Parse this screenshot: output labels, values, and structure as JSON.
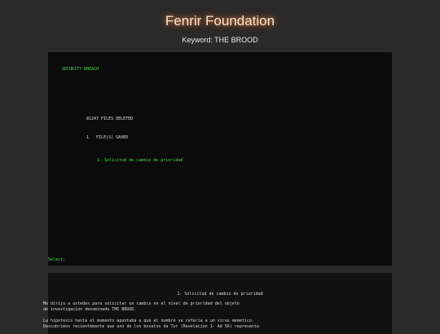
{
  "header": {
    "title": "Fenrir Foundation",
    "keyword": "Keyword: THE BROOD"
  },
  "terminal": {
    "alert": "SECURITY BREACH",
    "deleted": "81247 FILES DELETED",
    "saved": "1   FILE(S) SAVED",
    "file_link": "1- Solicitud de cambio de prioridad",
    "prompt": "Select:"
  },
  "document": {
    "title": "1- Solicitud de cambio de prioridad",
    "lines": [
      "Me dirijo a ustedes para solicitar un cambio en el nivel de prioridad del objeto",
      "de investigación denominado THE BROOD.",
      "La hipotesis hasta el momento apuntaba a que el nombre se refería a un virus memetico.",
      "Descubrimos recientemente que uno de los bocetos da Tyr (Revelacion 1- Ad 56) representa"
    ]
  },
  "colors": {
    "background": "#2a2a2a",
    "terminal_bg": "#0b0b0b",
    "terminal_green": "#46e046",
    "title_glow": "#ff8c3c"
  }
}
